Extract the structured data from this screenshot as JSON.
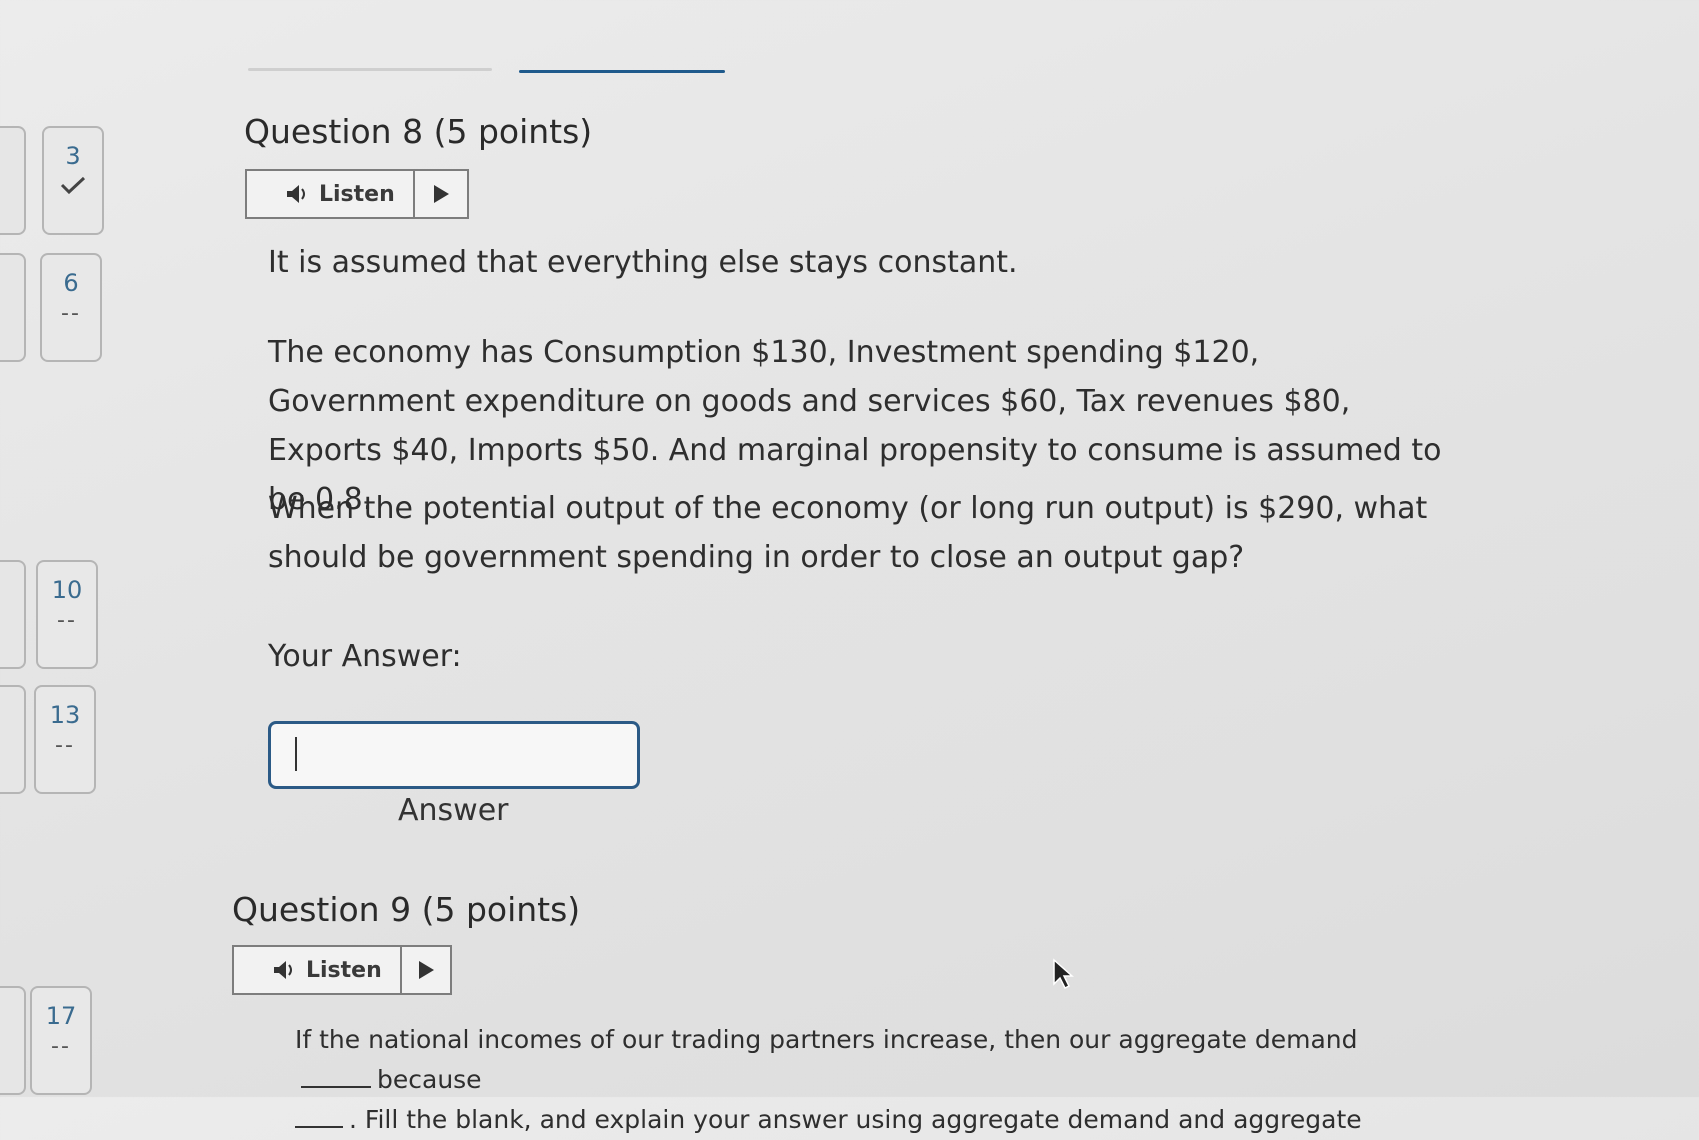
{
  "nav": [
    {
      "number": "3",
      "status": "check"
    },
    {
      "number": "6",
      "status": "--"
    },
    {
      "number": "10",
      "status": "--"
    },
    {
      "number": "13",
      "status": "--"
    },
    {
      "number": "17",
      "status": "--"
    }
  ],
  "question8": {
    "title": "Question 8",
    "points": "(5 points)",
    "listen_label": "Listen",
    "p1": "It is assumed that everything else stays constant.",
    "p2": "The economy has Consumption $130, Investment spending $120, Government expenditure on goods and services $60, Tax revenues $80, Exports $40, Imports $50. And marginal propensity to consume is assumed to be 0.8.",
    "p3": "When the potential output of the economy (or long run output) is $290, what should be government spending in order to close an output gap?",
    "your_answer_label": "Your Answer:",
    "answer_placeholder": "",
    "answer_caption": "Answer"
  },
  "question9": {
    "title": "Question 9",
    "points": "(5 points)",
    "listen_label": "Listen",
    "text_part1": "If the national incomes of our trading partners increase, then our aggregate demand",
    "text_part2": "because",
    "text_part3": ". Fill the blank, and explain your answer using aggregate demand and aggregate"
  },
  "colors": {
    "accent": "#2b5a86",
    "nav_number": "#3a6b8f"
  }
}
